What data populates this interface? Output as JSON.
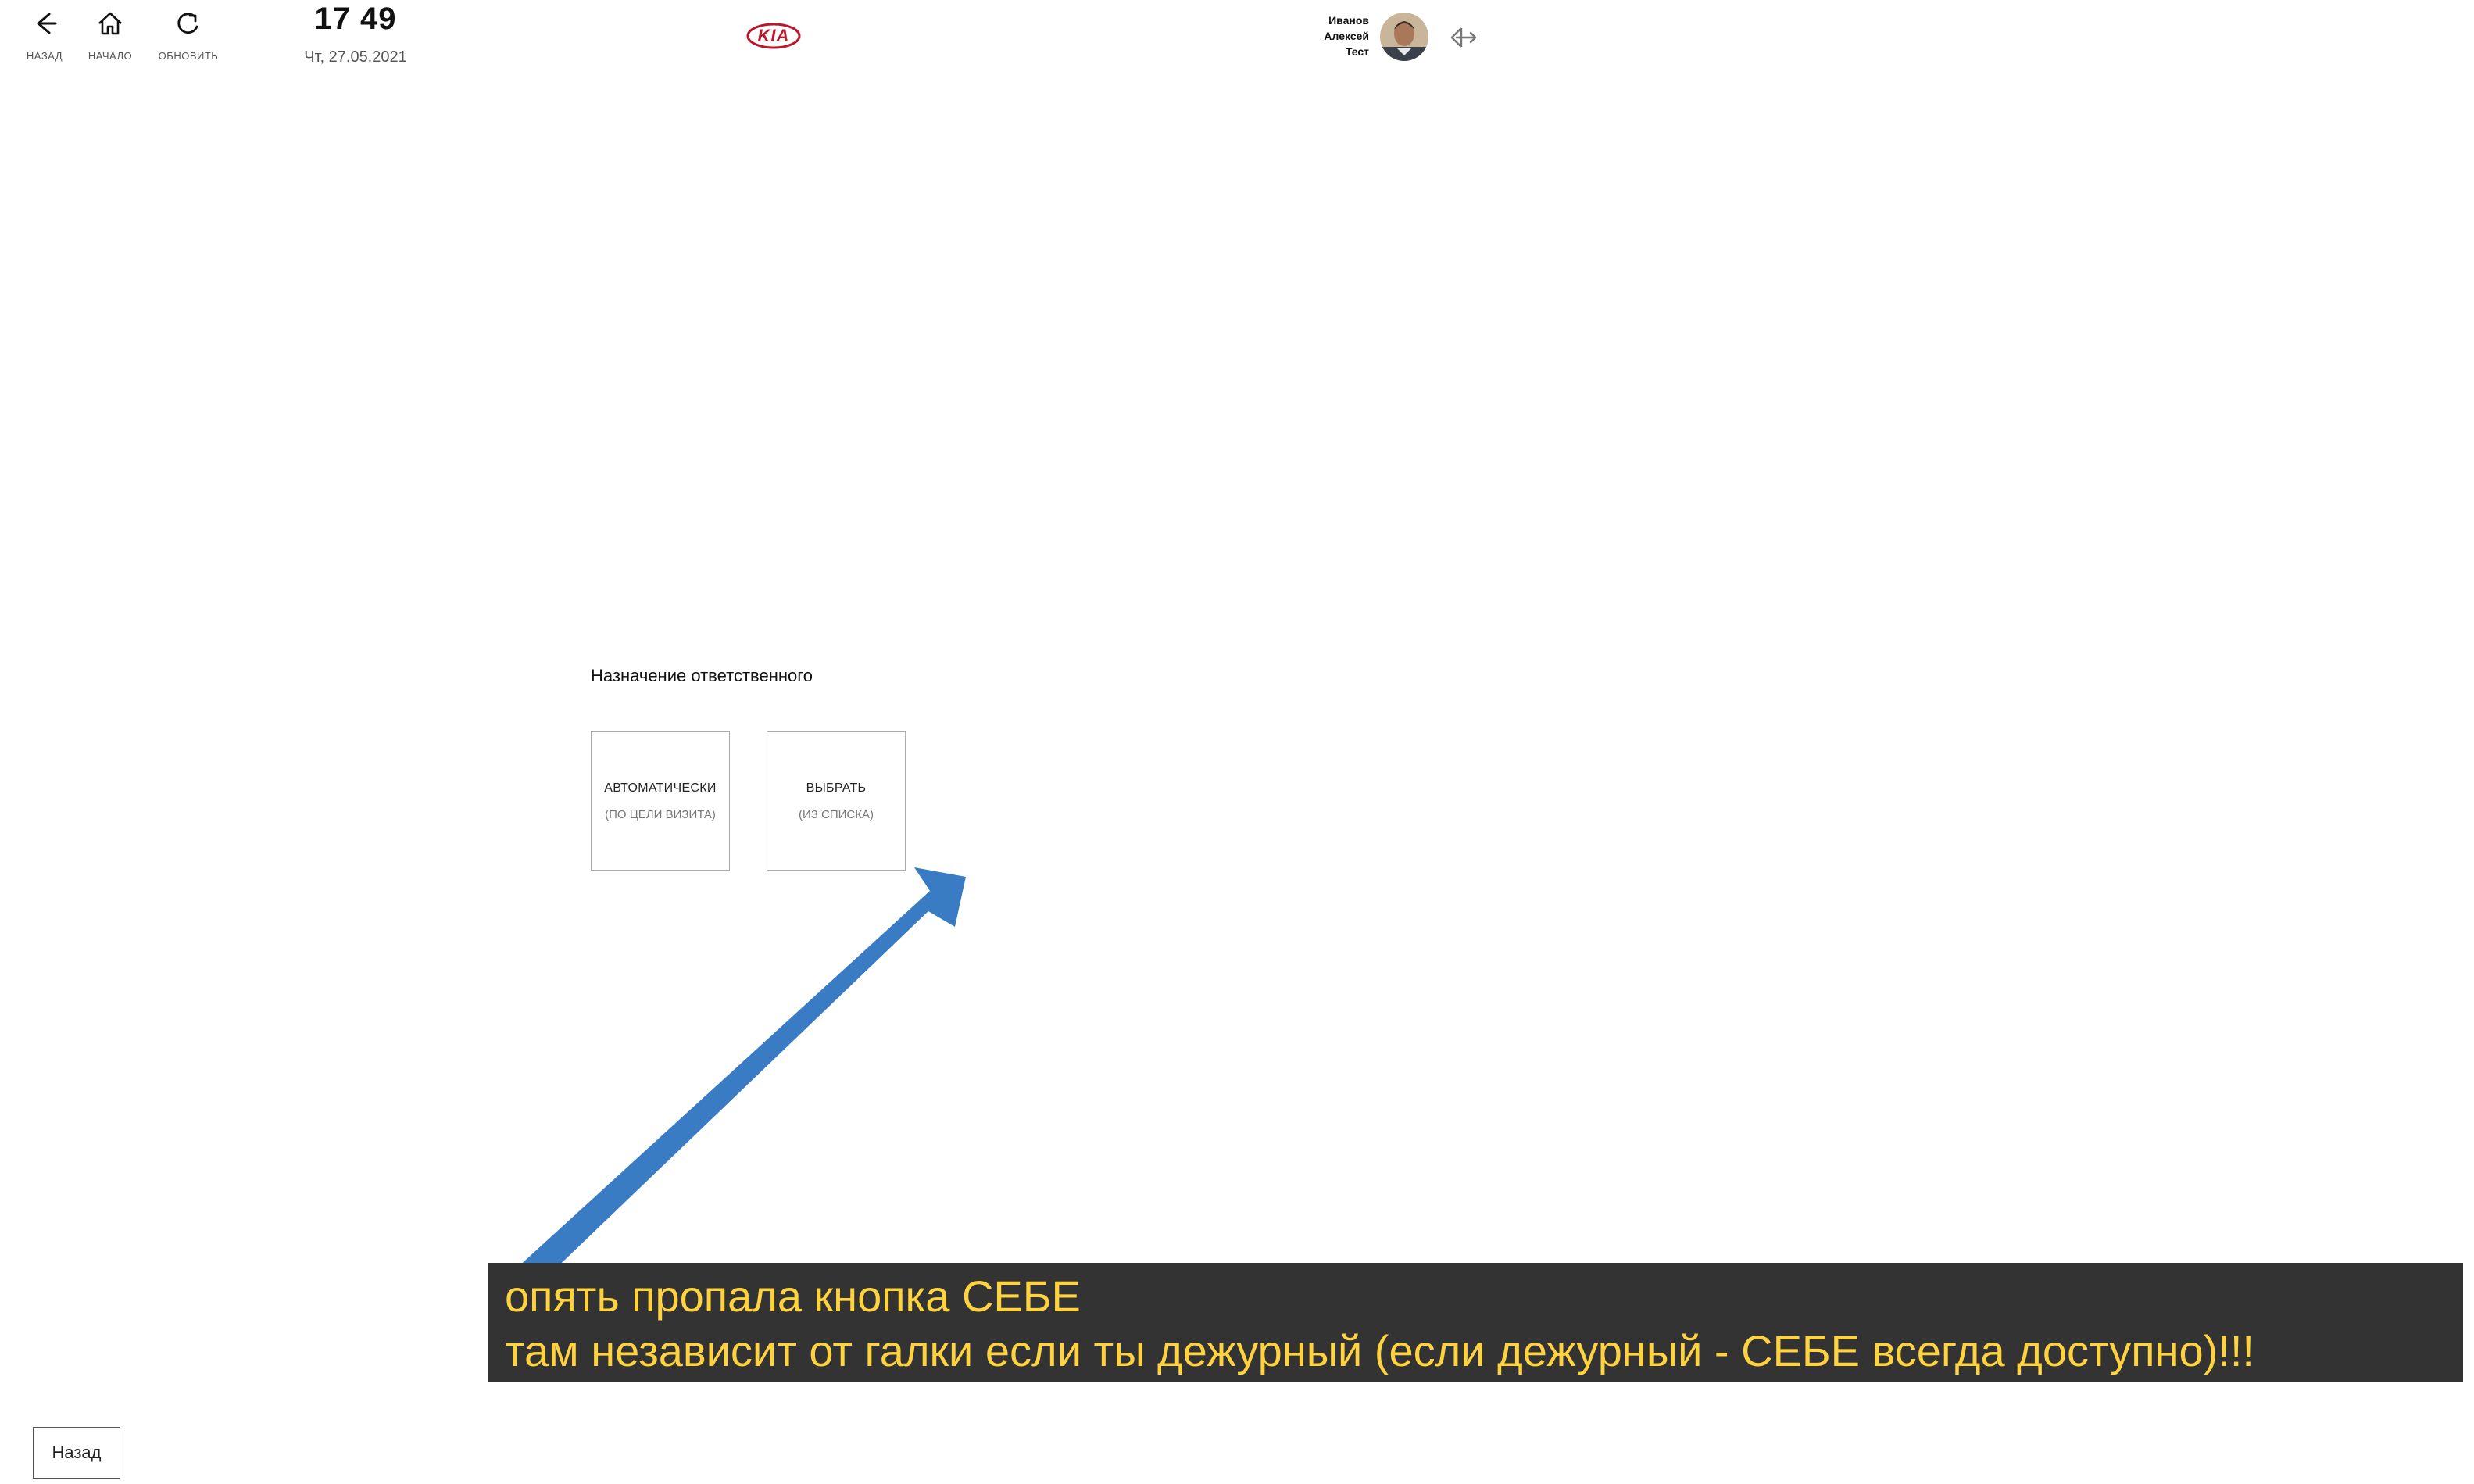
{
  "header": {
    "nav": [
      {
        "id": "back",
        "label": "НАЗАД",
        "icon": "arrow-left-icon"
      },
      {
        "id": "home",
        "label": "НАЧАЛО",
        "icon": "home-icon"
      },
      {
        "id": "refresh",
        "label": "ОБНОВИТЬ",
        "icon": "refresh-icon"
      }
    ],
    "clock": {
      "time": "17 49",
      "date": "Чт, 27.05.2021"
    },
    "logo_text": "KIA",
    "user": {
      "line1": "Иванов",
      "line2": "Алексей",
      "line3": "Тест",
      "avatar_icon": "user-avatar",
      "logout_icon": "logout-icon"
    }
  },
  "main": {
    "title": "Назначение ответственного",
    "options": [
      {
        "title": "АВТОМАТИЧЕСКИ",
        "subtitle": "(ПО ЦЕЛИ ВИЗИТА)"
      },
      {
        "title": "ВЫБРАТЬ",
        "subtitle": "(ИЗ СПИСКА)"
      }
    ]
  },
  "footer": {
    "back_label": "Назад"
  },
  "annotation": {
    "line1": "опять пропала кнопка СЕБЕ",
    "line2": "там независит от галки если ты дежурный (если дежурный - СЕБЕ всегда доступно)!!!",
    "box_color": "#333333",
    "text_color": "#ffd23f",
    "arrow_color": "#3a7cc4"
  },
  "colors": {
    "brand_red": "#bb162b",
    "background": "#ffffff"
  }
}
